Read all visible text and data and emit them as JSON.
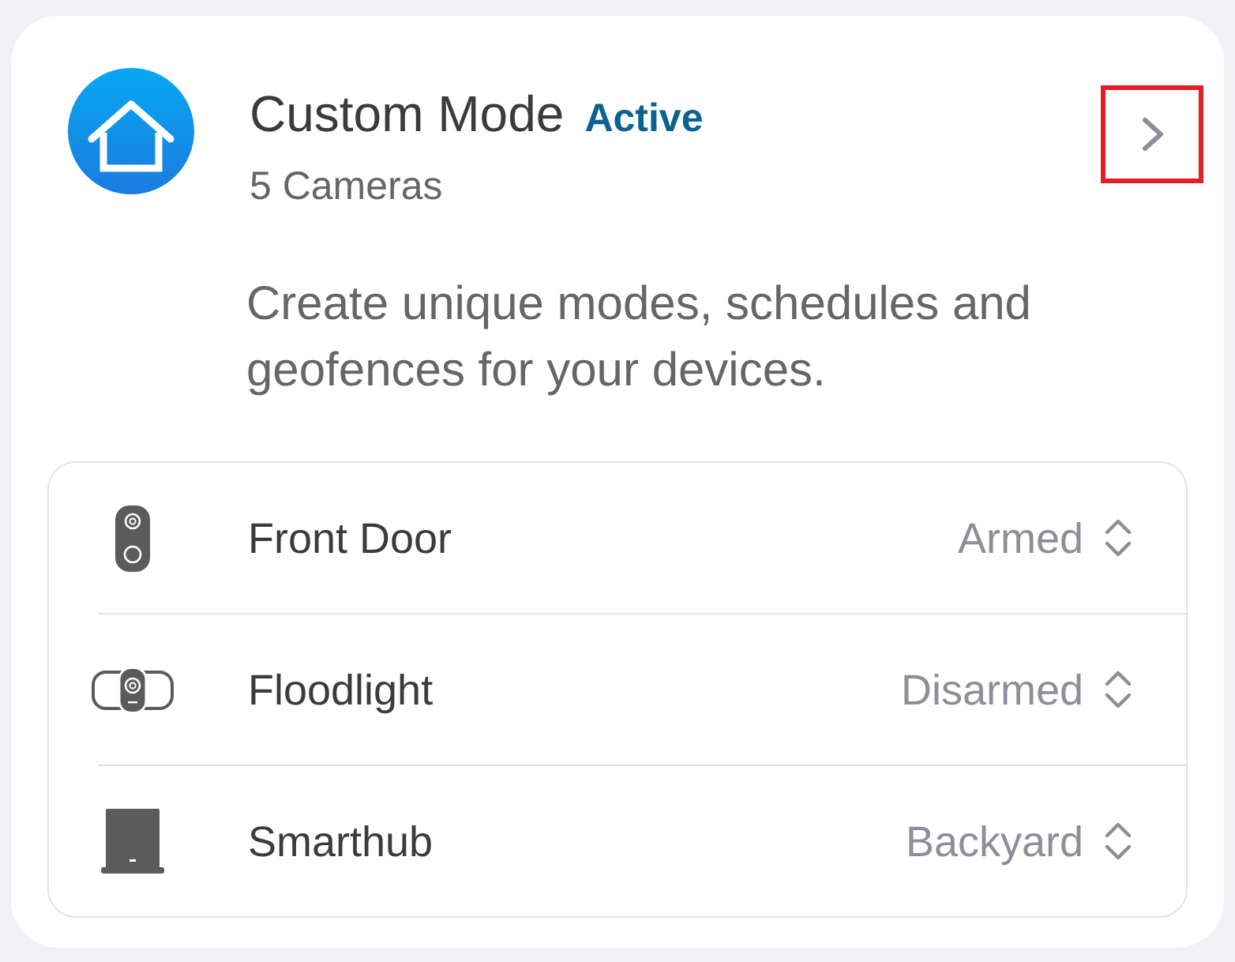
{
  "mode": {
    "title": "Custom Mode",
    "status": "Active",
    "subtitle": "5 Cameras",
    "next_button": {
      "highlighted": true
    }
  },
  "description": "Create unique modes, schedules and geofences for your devices.",
  "devices": [
    {
      "kind": "doorbell",
      "name": "Front Door",
      "setting": "Armed"
    },
    {
      "kind": "floodlight",
      "name": "Floodlight",
      "setting": "Disarmed"
    },
    {
      "kind": "hub",
      "name": "Smarthub",
      "setting": "Backyard"
    }
  ]
}
